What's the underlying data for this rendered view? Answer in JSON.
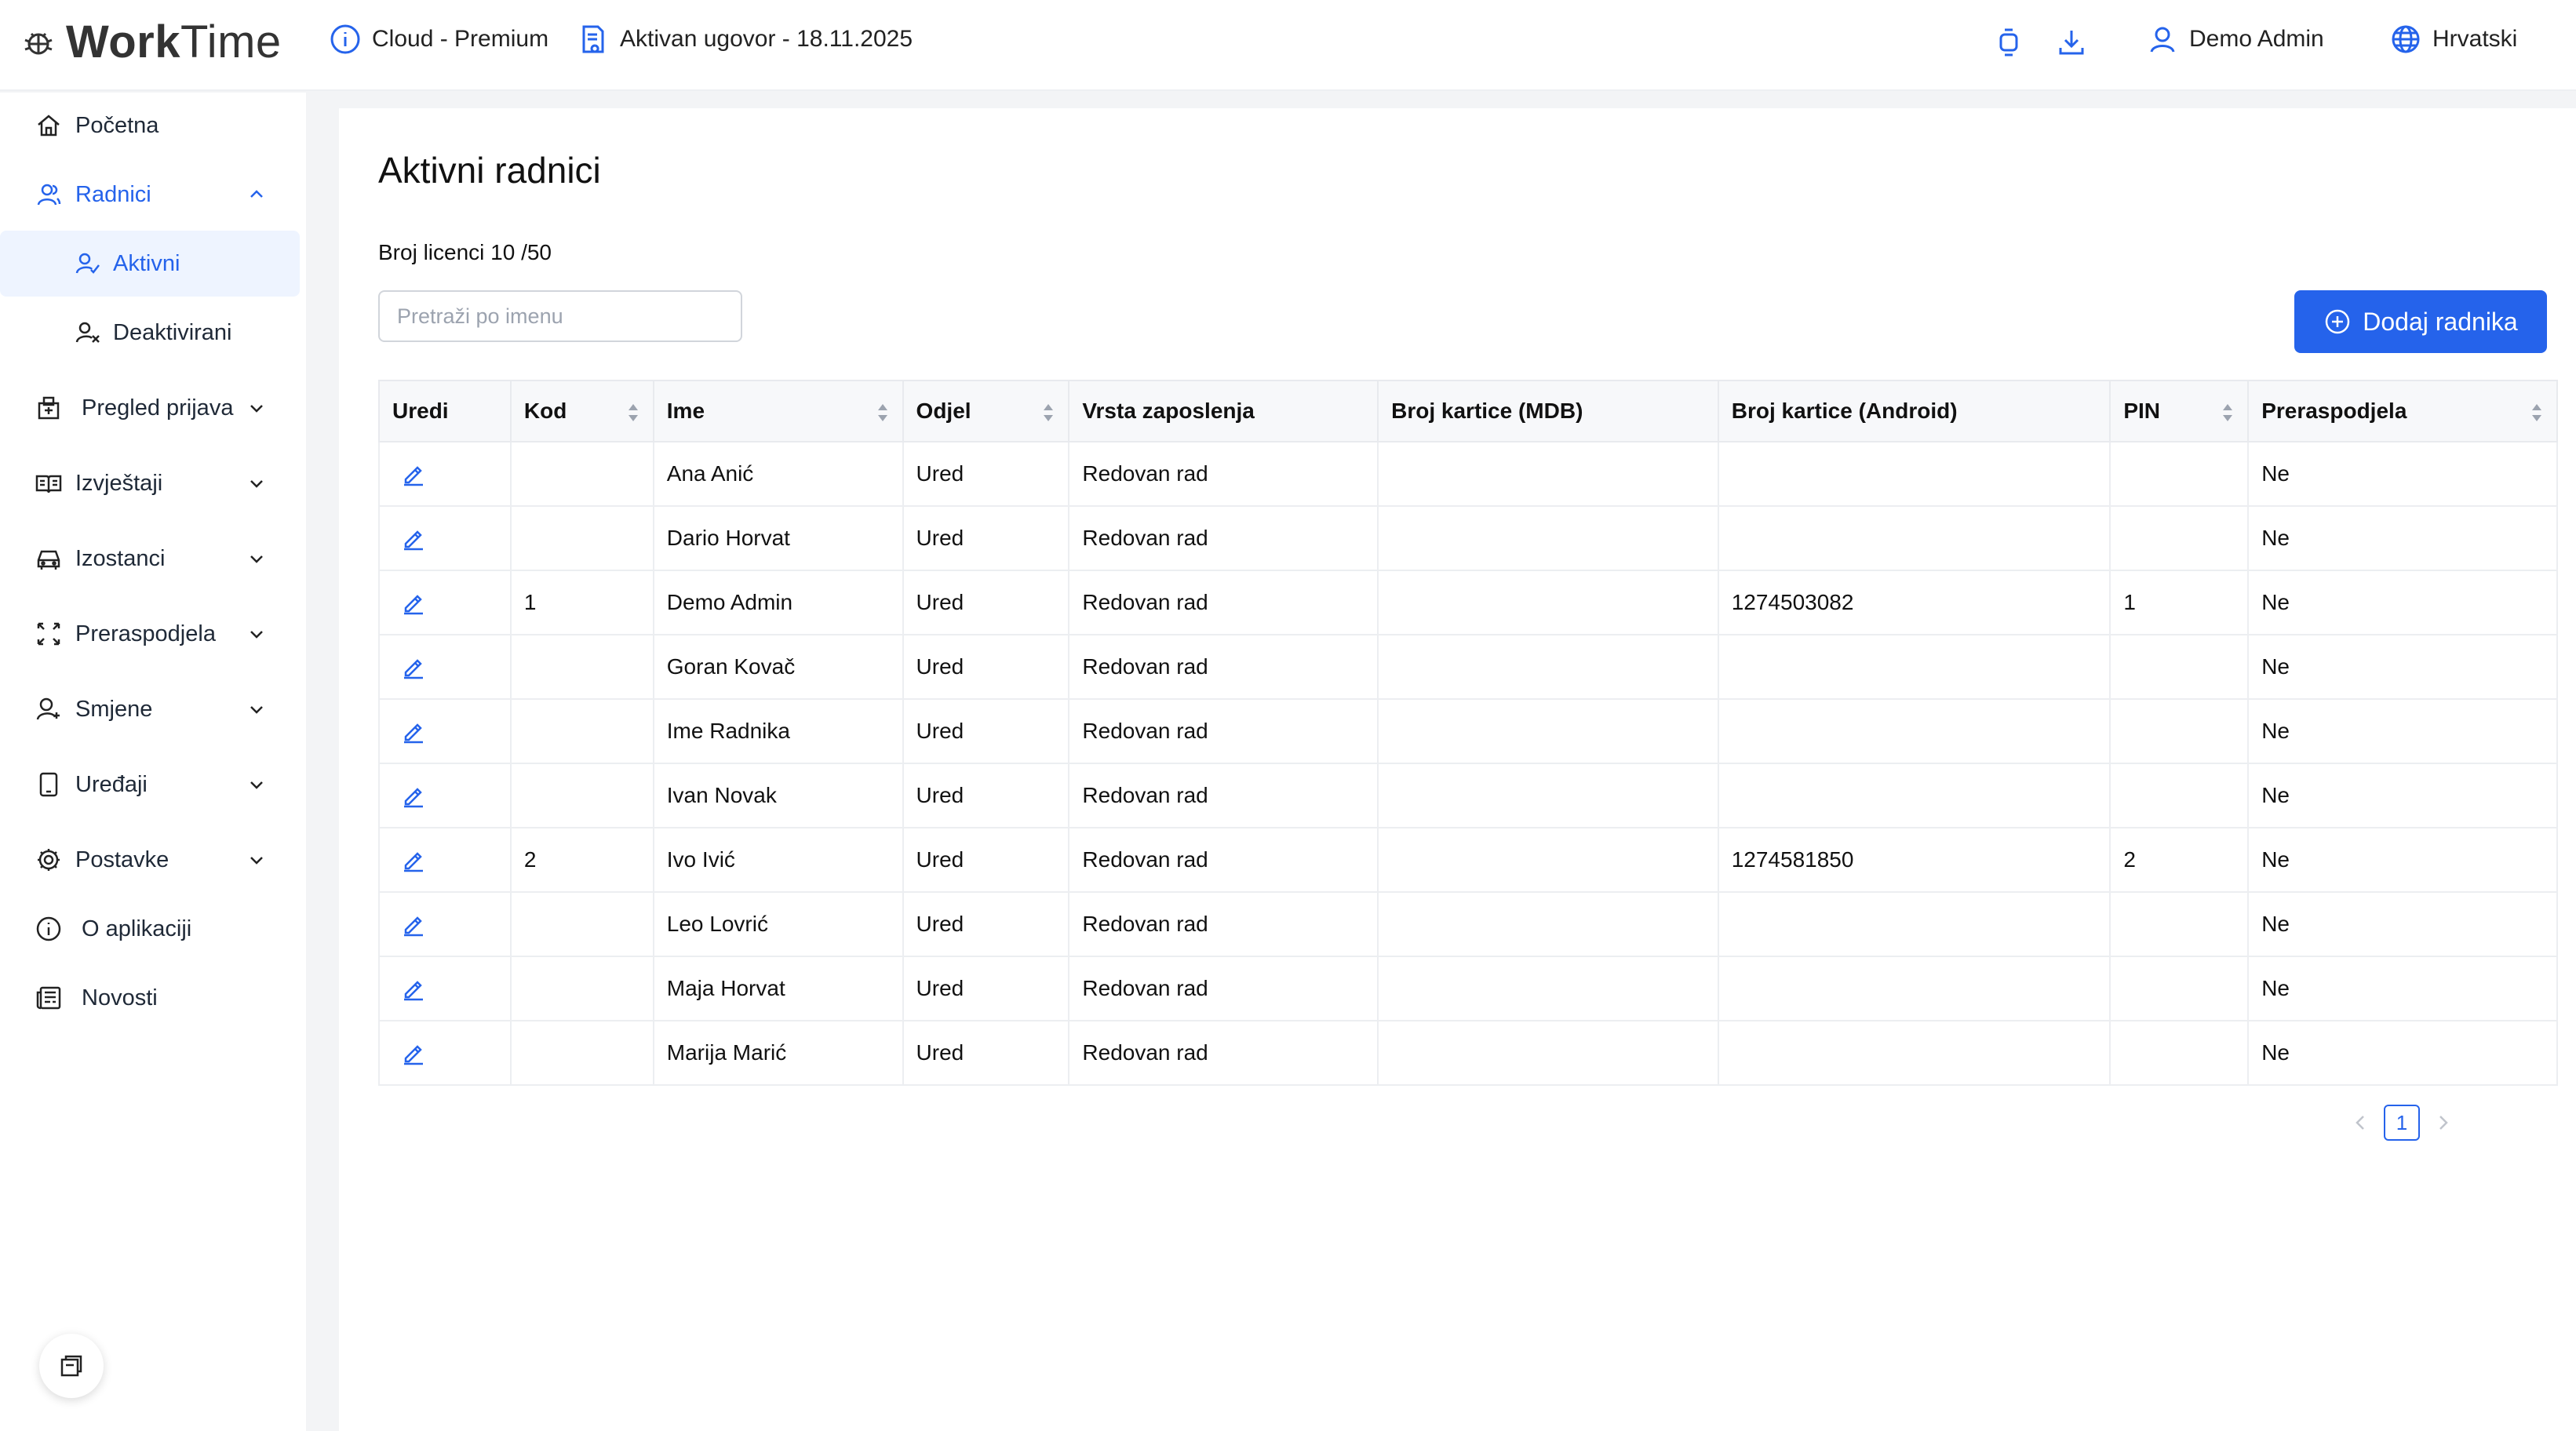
{
  "app": {
    "logo_text_bold": "Work",
    "logo_text_rest": "Time",
    "plan": "Cloud - Premium",
    "contract": "Aktivan ugovor - 18.11.2025",
    "user": "Demo Admin",
    "language": "Hrvatski"
  },
  "sidebar": {
    "items": [
      {
        "label": "Početna",
        "icon": "home-icon"
      },
      {
        "label": "Radnici",
        "icon": "users-icon"
      },
      {
        "label": "Aktivni",
        "icon": "user-check-icon"
      },
      {
        "label": "Deaktivirani",
        "icon": "user-x-icon"
      },
      {
        "label": "Pregled prijava",
        "icon": "clipboard-icon"
      },
      {
        "label": "Izvještaji",
        "icon": "book-icon"
      },
      {
        "label": "Izostanci",
        "icon": "car-icon"
      },
      {
        "label": "Preraspodjela",
        "icon": "shuffle-icon"
      },
      {
        "label": "Smjene",
        "icon": "user-icon"
      },
      {
        "label": "Uređaji",
        "icon": "tablet-icon"
      },
      {
        "label": "Postavke",
        "icon": "gear-icon"
      },
      {
        "label": "O aplikaciji",
        "icon": "info-icon"
      },
      {
        "label": "Novosti",
        "icon": "news-icon"
      }
    ]
  },
  "main": {
    "title": "Aktivni radnici",
    "license_count": "Broj licenci 10 /50",
    "search_placeholder": "Pretraži po imenu",
    "add_button": "Dodaj radnika",
    "columns": [
      "Uredi",
      "Kod",
      "Ime",
      "Odjel",
      "Vrsta zaposlenja",
      "Broj kartice (MDB)",
      "Broj kartice (Android)",
      "PIN",
      "Preraspodjela"
    ],
    "rows": [
      {
        "kod": "",
        "ime": "Ana Anić",
        "odjel": "Ured",
        "vrsta": "Redovan rad",
        "mdb": "",
        "android": "",
        "pin": "",
        "preraspodjela": "Ne"
      },
      {
        "kod": "",
        "ime": "Dario Horvat",
        "odjel": "Ured",
        "vrsta": "Redovan rad",
        "mdb": "",
        "android": "",
        "pin": "",
        "preraspodjela": "Ne"
      },
      {
        "kod": "1",
        "ime": "Demo Admin",
        "odjel": "Ured",
        "vrsta": "Redovan rad",
        "mdb": "",
        "android": "1274503082",
        "pin": "1",
        "preraspodjela": "Ne"
      },
      {
        "kod": "",
        "ime": "Goran Kovač",
        "odjel": "Ured",
        "vrsta": "Redovan rad",
        "mdb": "",
        "android": "",
        "pin": "",
        "preraspodjela": "Ne"
      },
      {
        "kod": "",
        "ime": "Ime Radnika",
        "odjel": "Ured",
        "vrsta": "Redovan rad",
        "mdb": "",
        "android": "",
        "pin": "",
        "preraspodjela": "Ne"
      },
      {
        "kod": "",
        "ime": "Ivan Novak",
        "odjel": "Ured",
        "vrsta": "Redovan rad",
        "mdb": "",
        "android": "",
        "pin": "",
        "preraspodjela": "Ne"
      },
      {
        "kod": "2",
        "ime": "Ivo Ivić",
        "odjel": "Ured",
        "vrsta": "Redovan rad",
        "mdb": "",
        "android": "1274581850",
        "pin": "2",
        "preraspodjela": "Ne"
      },
      {
        "kod": "",
        "ime": "Leo Lovrić",
        "odjel": "Ured",
        "vrsta": "Redovan rad",
        "mdb": "",
        "android": "",
        "pin": "",
        "preraspodjela": "Ne"
      },
      {
        "kod": "",
        "ime": "Maja Horvat",
        "odjel": "Ured",
        "vrsta": "Redovan rad",
        "mdb": "",
        "android": "",
        "pin": "",
        "preraspodjela": "Ne"
      },
      {
        "kod": "",
        "ime": "Marija Marić",
        "odjel": "Ured",
        "vrsta": "Redovan rad",
        "mdb": "",
        "android": "",
        "pin": "",
        "preraspodjela": "Ne"
      }
    ],
    "pagination": {
      "current_page": "1"
    }
  },
  "colors": {
    "accent": "#2563eb",
    "selected_bg": "#eef4ff"
  }
}
